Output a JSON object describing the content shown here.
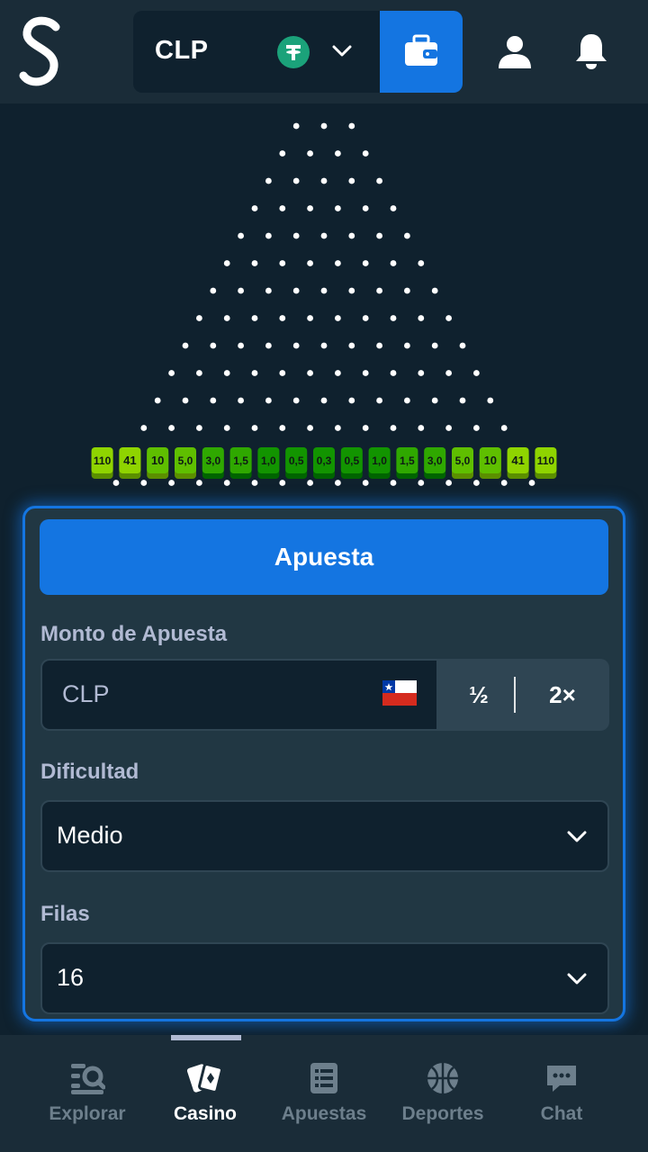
{
  "header": {
    "currency": "CLP",
    "token_icon": "tether-icon",
    "wallet_icon": "wallet-icon"
  },
  "game": {
    "rows": 16,
    "multipliers": [
      "110",
      "41",
      "10",
      "5,0",
      "3,0",
      "1,5",
      "1,0",
      "0,5",
      "0,3",
      "0,5",
      "1,0",
      "1,5",
      "3,0",
      "5,0",
      "10",
      "41",
      "110"
    ]
  },
  "panel": {
    "bet_button": "Apuesta",
    "amount_label": "Monto de Apuesta",
    "amount_placeholder": "CLP",
    "half_label": "½",
    "double_label": "2×",
    "difficulty_label": "Dificultad",
    "difficulty_value": "Medio",
    "rows_label": "Filas",
    "rows_value": "16"
  },
  "nav": {
    "items": [
      {
        "label": "Explorar",
        "icon": "explore-icon"
      },
      {
        "label": "Casino",
        "icon": "casino-icon",
        "active": true
      },
      {
        "label": "Apuestas",
        "icon": "bets-icon"
      },
      {
        "label": "Deportes",
        "icon": "sports-icon"
      },
      {
        "label": "Chat",
        "icon": "chat-icon"
      }
    ]
  },
  "colors": {
    "accent": "#1475e1",
    "bg": "#0f212e",
    "panel": "#213743",
    "tether": "#1ba27a"
  }
}
